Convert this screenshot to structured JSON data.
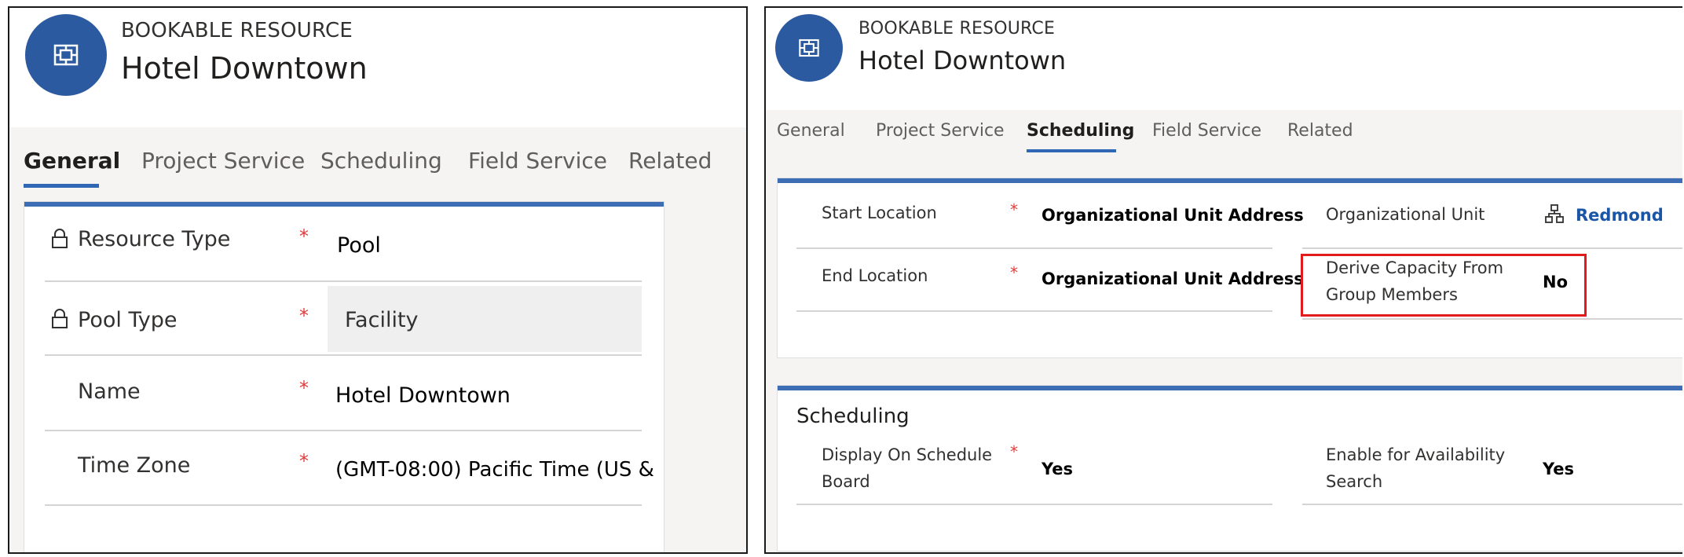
{
  "colors": {
    "accent": "#2f67b4",
    "avatar": "#2c5aa0",
    "required": "#e23b3b",
    "highlight": "#e21c1c",
    "link": "#1b56a6"
  },
  "left": {
    "header": {
      "avatar_icon": "bookable-resource-icon",
      "entity_label": "BOOKABLE RESOURCE",
      "title": "Hotel Downtown"
    },
    "tabs": [
      {
        "label": "General",
        "active": true
      },
      {
        "label": "Project Service",
        "active": false
      },
      {
        "label": "Scheduling",
        "active": false
      },
      {
        "label": "Field Service",
        "active": false
      },
      {
        "label": "Related",
        "active": false
      }
    ],
    "fields": [
      {
        "label": "Resource Type",
        "required": "*",
        "value": "Pool",
        "locked": true
      },
      {
        "label": "Pool Type",
        "required": "*",
        "value": "Facility",
        "locked": true
      },
      {
        "label": "Name",
        "required": "*",
        "value": "Hotel Downtown",
        "locked": false
      },
      {
        "label": "Time Zone",
        "required": "*",
        "value": "(GMT-08:00) Pacific Time (US &",
        "locked": false
      }
    ]
  },
  "right": {
    "header": {
      "avatar_icon": "bookable-resource-icon",
      "entity_label": "BOOKABLE RESOURCE",
      "title": "Hotel Downtown"
    },
    "tabs": [
      {
        "label": "General",
        "active": false
      },
      {
        "label": "Project Service",
        "active": false
      },
      {
        "label": "Scheduling",
        "active": true
      },
      {
        "label": "Field Service",
        "active": false
      },
      {
        "label": "Related",
        "active": false
      }
    ],
    "location_fields": [
      {
        "label": "Start Location",
        "required": "*",
        "value": "Organizational Unit Address"
      },
      {
        "label": "End Location",
        "required": "*",
        "value": "Organizational Unit Address"
      }
    ],
    "org_unit": {
      "label": "Organizational Unit",
      "value": "Redmond",
      "icon": "org-hierarchy-icon"
    },
    "derive_capacity": {
      "label_line1": "Derive Capacity From",
      "label_line2": "Group Members",
      "value": "No"
    },
    "scheduling_section": {
      "title": "Scheduling",
      "display_on_board": {
        "label_line1": "Display On Schedule",
        "label_line2": "Board",
        "required": "*",
        "value": "Yes"
      },
      "availability_search": {
        "label_line1": "Enable for Availability",
        "label_line2": "Search",
        "value": "Yes"
      }
    }
  }
}
